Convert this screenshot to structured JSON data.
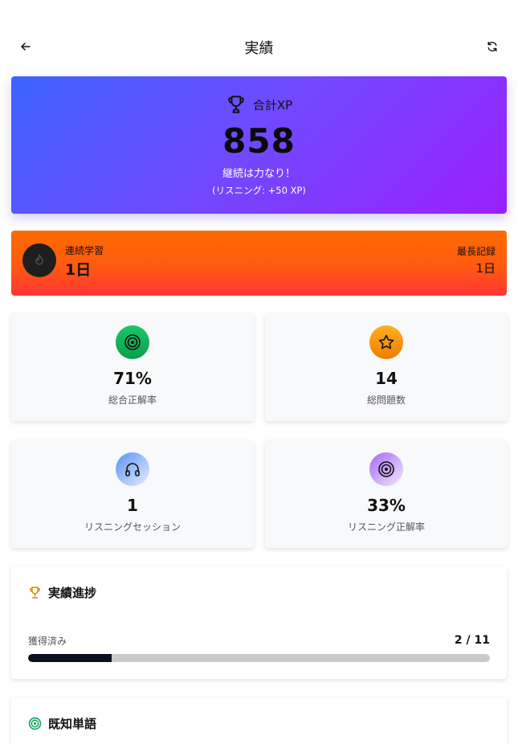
{
  "header": {
    "title": "実績",
    "back_icon": "arrow-left-icon",
    "refresh_icon": "refresh-icon"
  },
  "xp": {
    "label": "合計XP",
    "value": "858",
    "message": "継続は力なり！",
    "listening_bonus": "(リスニング: +50 XP)",
    "icon": "trophy-icon"
  },
  "streak": {
    "label": "連続学習",
    "value": "1日",
    "best_label": "最長記録",
    "best_value": "1日",
    "icon": "flame-icon"
  },
  "stats": [
    {
      "value": "71%",
      "label": "総合正解率",
      "icon": "target-icon",
      "color": "#12b55a"
    },
    {
      "value": "14",
      "label": "総問題数",
      "icon": "star-icon",
      "color": "#f59a0c"
    },
    {
      "value": "1",
      "label": "リスニングセッション",
      "icon": "headphones-icon",
      "color": "#7aa8f8"
    },
    {
      "value": "33%",
      "label": "リスニング正解率",
      "icon": "target-icon",
      "color": "#b68af7"
    }
  ],
  "achievements": {
    "title": "実績進捗",
    "earned_label": "獲得済み",
    "earned_count": "2 / 11",
    "progress_fraction": 0.18,
    "icon": "trophy-icon"
  },
  "known_words": {
    "title": "既知単語",
    "icon": "target-icon"
  },
  "colors": {
    "xp_gradient_start": "#3d63ff",
    "xp_gradient_end": "#9a20ff",
    "streak_gradient_start": "#ff6a00",
    "streak_gradient_end": "#ff3535",
    "progress_fill": "#0b0f1e"
  }
}
